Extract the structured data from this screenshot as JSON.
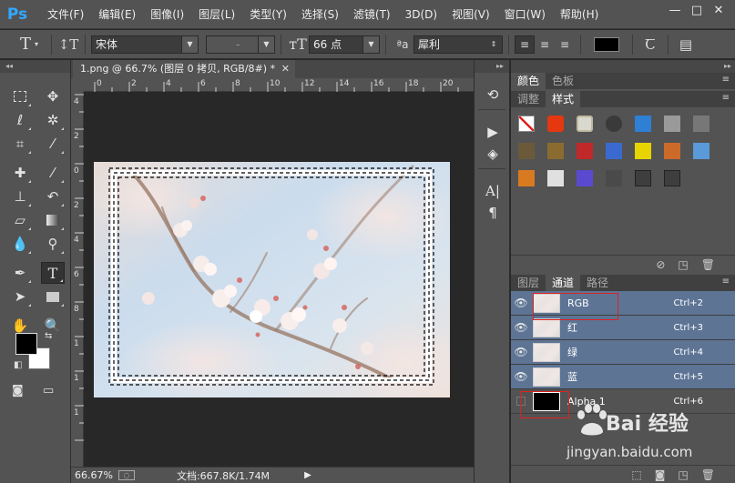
{
  "app": {
    "logo": "Ps"
  },
  "menu": [
    "文件(F)",
    "编辑(E)",
    "图像(I)",
    "图层(L)",
    "类型(Y)",
    "选择(S)",
    "滤镜(T)",
    "3D(D)",
    "视图(V)",
    "窗口(W)",
    "帮助(H)"
  ],
  "window_controls": {
    "minimize": "—",
    "restore": "□",
    "close": "✕"
  },
  "options": {
    "font_family": "宋体",
    "font_style": "-",
    "font_size": "66 点",
    "aa_label": "ªa",
    "antialias": "犀利",
    "text_color": "#000000"
  },
  "document": {
    "tab_title": "1.png @ 66.7% (图层 0 拷贝, RGB/8#) *",
    "close": "✕",
    "ruler_top": [
      "0",
      "2",
      "4",
      "6",
      "8",
      "10",
      "12",
      "14",
      "16",
      "18",
      "20"
    ],
    "ruler_left": [
      "4",
      "2",
      "0",
      "2",
      "4",
      "6",
      "8",
      "1",
      "1",
      "1"
    ],
    "zoom": "66.67%",
    "doc_info": "文档:667.8K/1.74M"
  },
  "panels": {
    "color_tabs": [
      "颜色",
      "色板"
    ],
    "style_tabs": [
      "调整",
      "样式"
    ],
    "layer_tabs": [
      "图层",
      "通道",
      "路径"
    ]
  },
  "styles": [
    "#ffffff",
    "#e53810",
    "#d9d9d0",
    "#3a3a3a",
    "#2f7fd4",
    "#9a9a9a",
    "#777777",
    "#6b5a3a",
    "#8a6b30",
    "#c0282a",
    "#3a6ad0",
    "#e8d400",
    "#cc6a2a",
    "#5a9ad8",
    "#d87a20",
    "#e0e0e0",
    "#5a4ad0",
    "#4a4a4a",
    "#3e3e3e",
    "#3e3e3e"
  ],
  "channels": [
    {
      "name": "RGB",
      "shortcut": "Ctrl+2",
      "visible": true
    },
    {
      "name": "红",
      "shortcut": "Ctrl+3",
      "visible": true
    },
    {
      "name": "绿",
      "shortcut": "Ctrl+4",
      "visible": true
    },
    {
      "name": "蓝",
      "shortcut": "Ctrl+5",
      "visible": true
    },
    {
      "name": "Alpha 1",
      "shortcut": "Ctrl+6",
      "visible": false
    }
  ],
  "watermark": {
    "text": "Bai 经验",
    "url": "jingyan.baidu.com"
  }
}
